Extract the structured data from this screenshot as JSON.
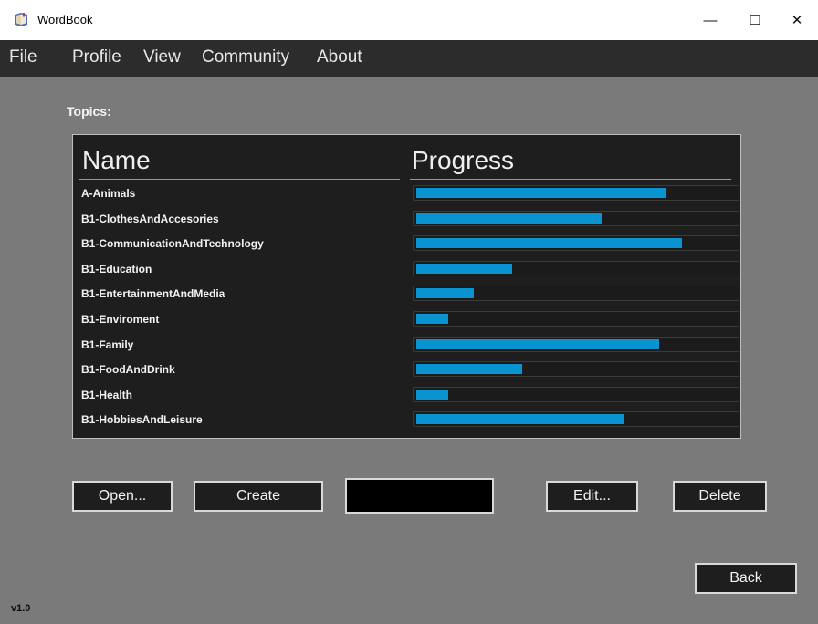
{
  "window": {
    "title": "WordBook",
    "minimize_glyph": "—",
    "maximize_glyph": "☐",
    "close_glyph": "✕"
  },
  "menu": {
    "items": [
      "File",
      "Profile",
      "View",
      "Community",
      "About"
    ]
  },
  "topics": {
    "label": "Topics:",
    "col_name": "Name",
    "col_progress": "Progress",
    "rows": [
      {
        "name": "A-Animals",
        "progress": 0.78
      },
      {
        "name": "B1-ClothesAndAccesories",
        "progress": 0.58
      },
      {
        "name": "B1-CommunicationAndTechnology",
        "progress": 0.83
      },
      {
        "name": "B1-Education",
        "progress": 0.3
      },
      {
        "name": "B1-EntertainmentAndMedia",
        "progress": 0.18
      },
      {
        "name": "B1-Enviroment",
        "progress": 0.1
      },
      {
        "name": "B1-Family",
        "progress": 0.76
      },
      {
        "name": "B1-FoodAndDrink",
        "progress": 0.33
      },
      {
        "name": "B1-Health",
        "progress": 0.1
      },
      {
        "name": "B1-HobbiesAndLeisure",
        "progress": 0.65
      }
    ]
  },
  "buttons": {
    "open": "Open...",
    "create": "Create",
    "blank": "",
    "edit": "Edit...",
    "delete": "Delete",
    "back": "Back"
  },
  "version": "v1.0",
  "colors": {
    "progress_fill": "#0a93d1",
    "list_bg": "#1e1e1e",
    "page_bg": "#7a7a7a",
    "menubar_bg": "#2c2c2c"
  }
}
